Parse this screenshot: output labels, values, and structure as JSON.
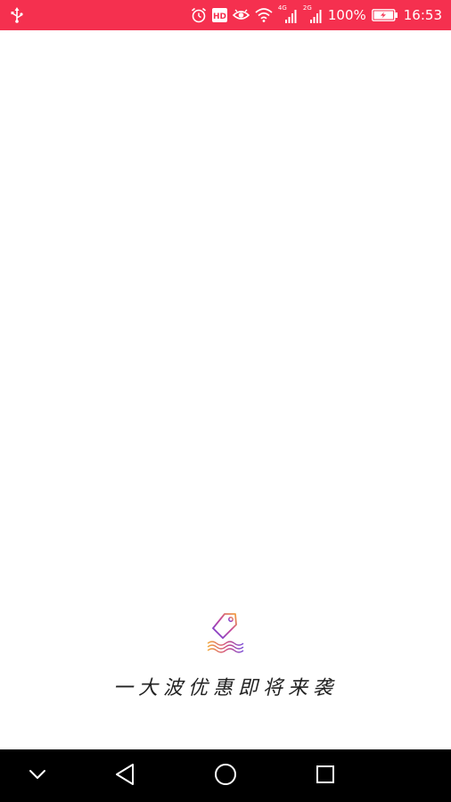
{
  "status_bar": {
    "background_color": "#f5304f",
    "icons_left": [
      "usb-icon"
    ],
    "icons_right": [
      "alarm-icon",
      "hd-icon",
      "eye-icon",
      "wifi-icon",
      "signal-4g-icon",
      "signal-2g-icon"
    ],
    "network_1": "4G",
    "network_2": "2G",
    "battery_percent": "100%",
    "time": "16:53"
  },
  "main": {
    "logo_icon": "price-tag-waves-icon",
    "tagline": "一大波优惠即将来袭"
  },
  "nav_bar": {
    "background_color": "#000000",
    "buttons": [
      "chevron-down-icon",
      "back-triangle-icon",
      "home-circle-icon",
      "recent-apps-square-icon"
    ]
  }
}
